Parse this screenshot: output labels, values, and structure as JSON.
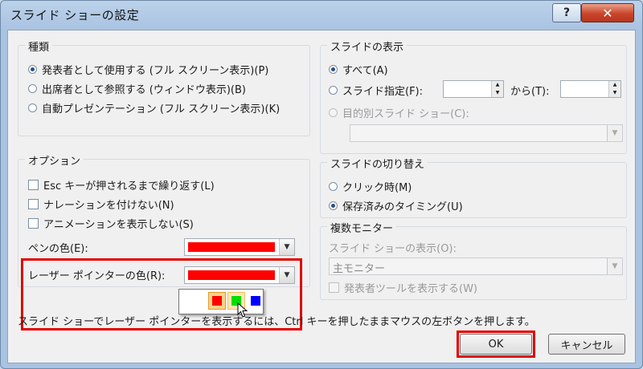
{
  "window": {
    "title": "スライド ショーの設定",
    "help_label": "?",
    "close_label": "✕"
  },
  "type_group": {
    "legend": "種類",
    "options": [
      {
        "label": "発表者として使用する (フル スクリーン表示)(P)",
        "selected": true
      },
      {
        "label": "出席者として参照する (ウィンドウ表示)(B)",
        "selected": false
      },
      {
        "label": "自動プレゼンテーション (フル スクリーン表示)(K)",
        "selected": false
      }
    ]
  },
  "options_group": {
    "legend": "オプション",
    "checks": [
      {
        "label": "Esc キーが押されるまで繰り返す(L)",
        "checked": false
      },
      {
        "label": "ナレーションを付けない(N)",
        "checked": false
      },
      {
        "label": "アニメーションを表示しない(S)",
        "checked": false
      }
    ],
    "pen_color_label": "ペンの色(E):",
    "laser_color_label": "レーザー ポインターの色(R):"
  },
  "color_popup": {
    "colors": [
      "#ff0000",
      "#00dd00",
      "#0000ff"
    ],
    "selected_index": 0,
    "hovered_index": 1
  },
  "show_slides": {
    "legend": "スライドの表示",
    "all_label": "すべて(A)",
    "range_label": "スライド指定(F):",
    "from_value": "",
    "to_label": "から(T):",
    "to_value": "",
    "custom_label": "目的別スライド ショー(C):",
    "custom_value": ""
  },
  "advance": {
    "legend": "スライドの切り替え",
    "manual_label": "クリック時(M)",
    "timings_label": "保存済みのタイミング(U)"
  },
  "monitors": {
    "legend": "複数モニター",
    "show_on_label": "スライド ショーの表示(O):",
    "show_on_value": "主モニター",
    "presenter_view_label": "発表者ツールを表示する(W)"
  },
  "hint": "スライド ショーでレーザー ポインターを表示するには、Ctrl キーを押したままマウスの左ボタンを押します。",
  "buttons": {
    "ok": "OK",
    "cancel": "キャンセル"
  }
}
